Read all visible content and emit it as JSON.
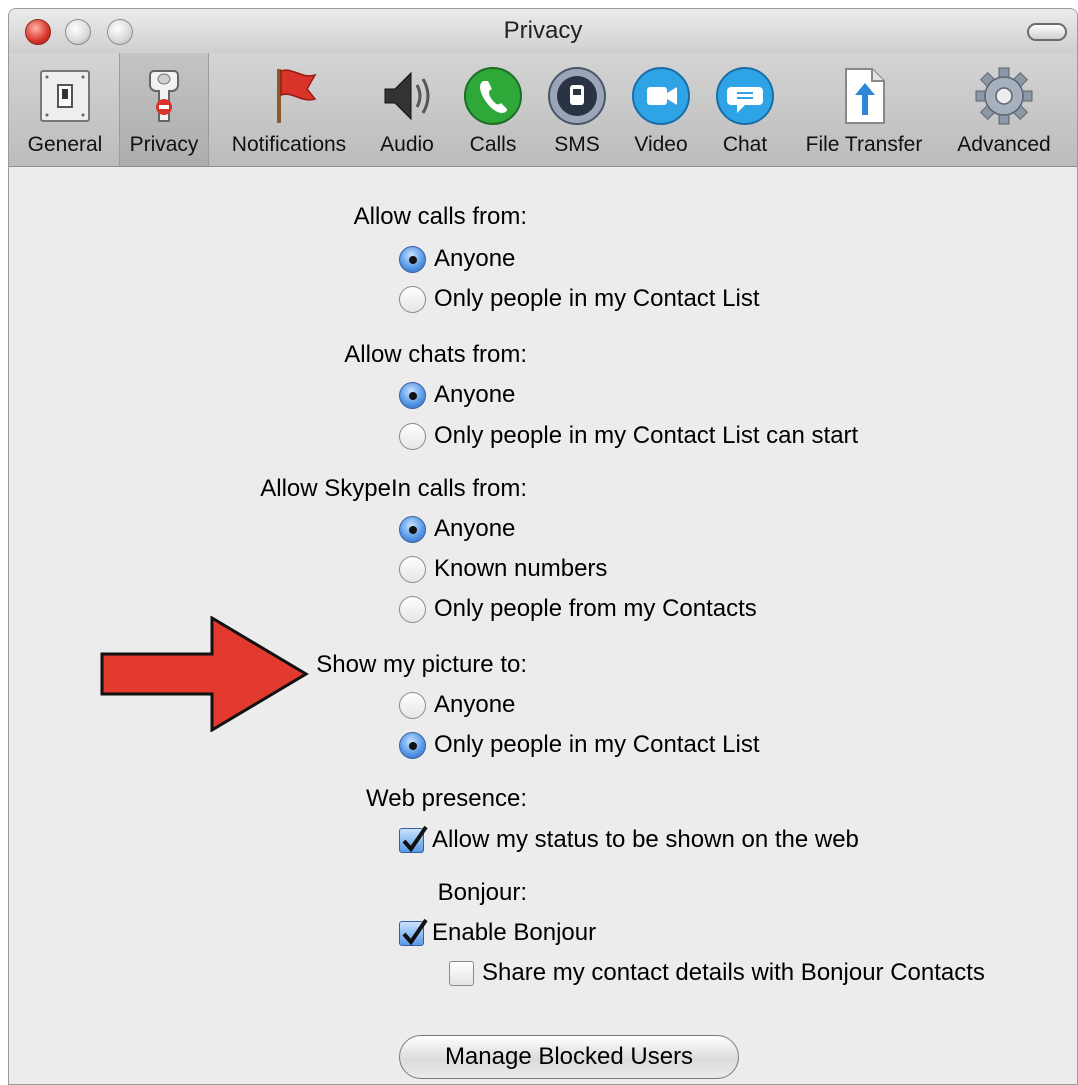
{
  "window": {
    "title": "Privacy"
  },
  "toolbar": {
    "items": [
      {
        "label": "General",
        "icon": "switch-icon"
      },
      {
        "label": "Privacy",
        "icon": "privacy-sign-icon",
        "selected": true
      },
      {
        "label": "Notifications",
        "icon": "flag-icon"
      },
      {
        "label": "Audio",
        "icon": "speaker-icon"
      },
      {
        "label": "Calls",
        "icon": "phone-icon"
      },
      {
        "label": "SMS",
        "icon": "sms-icon"
      },
      {
        "label": "Video",
        "icon": "video-icon"
      },
      {
        "label": "Chat",
        "icon": "chat-icon"
      },
      {
        "label": "File Transfer",
        "icon": "file-upload-icon"
      },
      {
        "label": "Advanced",
        "icon": "gear-icon"
      }
    ]
  },
  "privacy": {
    "calls": {
      "label": "Allow calls from:",
      "options": [
        "Anyone",
        "Only people in my Contact List"
      ],
      "selected": "Anyone"
    },
    "chats": {
      "label": "Allow chats from:",
      "options": [
        "Anyone",
        "Only people in my Contact List can start"
      ],
      "selected": "Anyone"
    },
    "skypein": {
      "label": "Allow SkypeIn calls from:",
      "options": [
        "Anyone",
        "Known numbers",
        "Only people from my Contacts"
      ],
      "selected": "Anyone"
    },
    "picture": {
      "label": "Show my picture to:",
      "options": [
        "Anyone",
        "Only people in my Contact List"
      ],
      "selected": "Only people in my Contact List"
    },
    "web": {
      "label": "Web presence:",
      "option": "Allow my status to be shown on the web",
      "checked": true
    },
    "bonjour": {
      "label": "Bonjour:",
      "enable": {
        "label": "Enable Bonjour",
        "checked": true
      },
      "share": {
        "label": "Share my contact details with Bonjour Contacts",
        "checked": false
      }
    },
    "manage_button": "Manage Blocked Users"
  },
  "colors": {
    "accent": "#3a7bd5",
    "arrow": "#e23a2e",
    "window_bg": "#ececec"
  }
}
